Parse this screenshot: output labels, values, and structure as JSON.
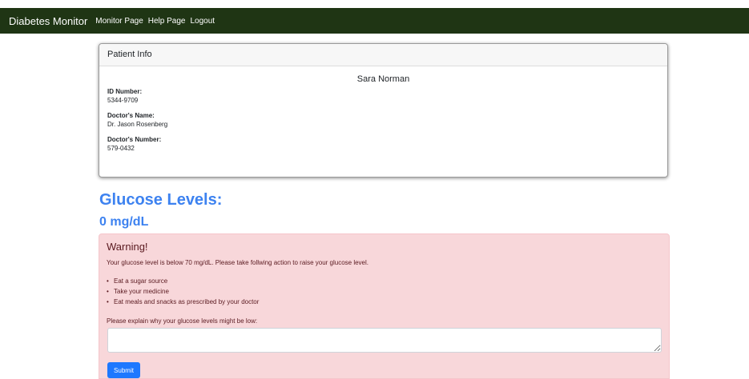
{
  "navbar": {
    "brand": "Diabetes Monitor",
    "links": [
      "Monitor Page",
      "Help Page",
      "Logout"
    ]
  },
  "patient_card": {
    "header": "Patient Info",
    "name": "Sara Norman",
    "fields": [
      {
        "label": "ID Number:",
        "value": "5344-9709"
      },
      {
        "label": "Doctor's Name:",
        "value": "Dr. Jason Rosenberg"
      },
      {
        "label": "Doctor's Number:",
        "value": "579-0432"
      }
    ]
  },
  "glucose": {
    "heading": "Glucose Levels:",
    "value": "0 mg/dL"
  },
  "warning": {
    "title": "Warning!",
    "message": "Your glucose level is below 70 mg/dL. Please take follwing action to raise your glucose level.",
    "actions": [
      "Eat a sugar source",
      "Take your medicine",
      "Eat meals and snacks as prescribed by your doctor"
    ],
    "explain_label": "Please explain why your glucose levels might be low:",
    "explain_value": "",
    "submit_label": "Submit"
  },
  "colors": {
    "navbar_bg": "#1f3514",
    "accent_blue": "#3d82f0",
    "alert_bg": "#f8d7da",
    "button_blue": "#1e78ff"
  }
}
